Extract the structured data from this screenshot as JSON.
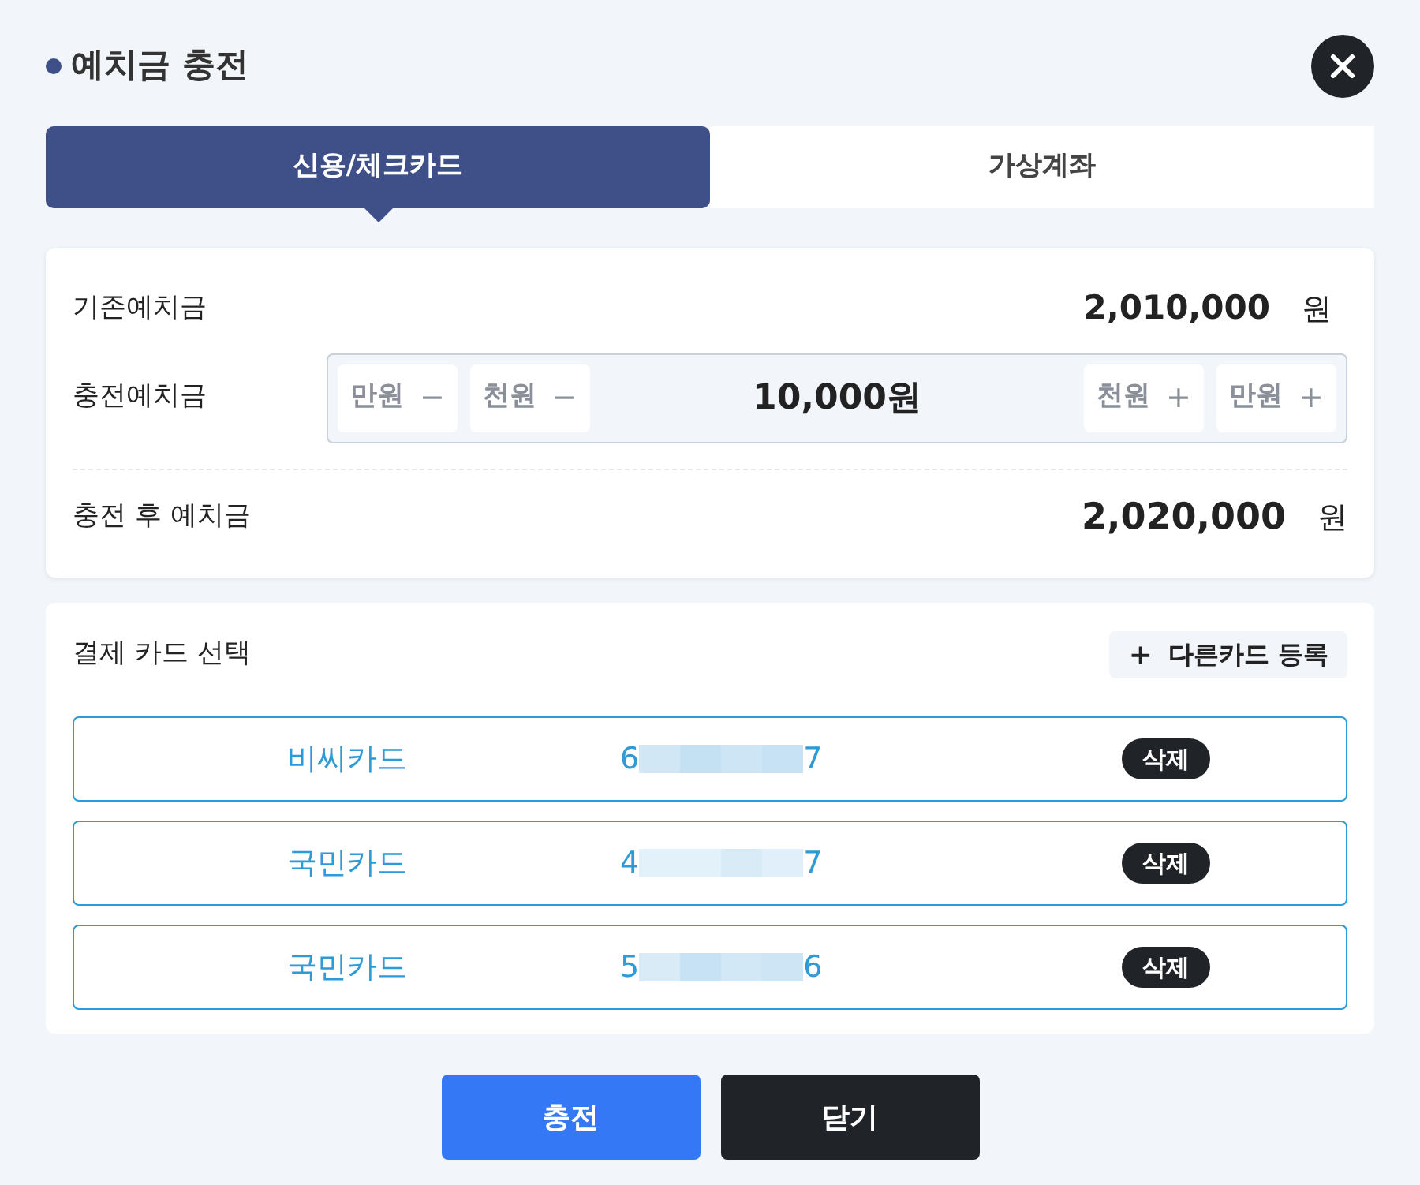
{
  "title": "예치금 충전",
  "tabs": [
    {
      "label": "신용/체크카드",
      "selected": true
    },
    {
      "label": "가상계좌",
      "selected": false
    }
  ],
  "summary": {
    "current": {
      "label": "기존예치금",
      "amount": "2,010,000",
      "unit": "원"
    },
    "charge": {
      "label": "충전예치금",
      "value": "10,000원",
      "minus": [
        {
          "label": "만원",
          "sign": "−"
        },
        {
          "label": "천원",
          "sign": "−"
        }
      ],
      "plus": [
        {
          "label": "천원",
          "sign": "+"
        },
        {
          "label": "만원",
          "sign": "+"
        }
      ]
    },
    "after": {
      "label": "충전 후 예치금",
      "amount": "2,020,000",
      "unit": "원"
    }
  },
  "cards": {
    "label": "결제 카드 선택",
    "add_button": {
      "icon": "+",
      "label": "다른카드 등록"
    },
    "items": [
      {
        "name": "비씨카드",
        "first": "6",
        "last": "7",
        "delete": "삭제"
      },
      {
        "name": "국민카드",
        "first": "4",
        "last": "7",
        "delete": "삭제"
      },
      {
        "name": "국민카드",
        "first": "5",
        "last": "6",
        "delete": "삭제"
      }
    ]
  },
  "buttons": [
    {
      "label": "충전",
      "kind": "primary"
    },
    {
      "label": "닫기",
      "kind": "secondary"
    }
  ]
}
